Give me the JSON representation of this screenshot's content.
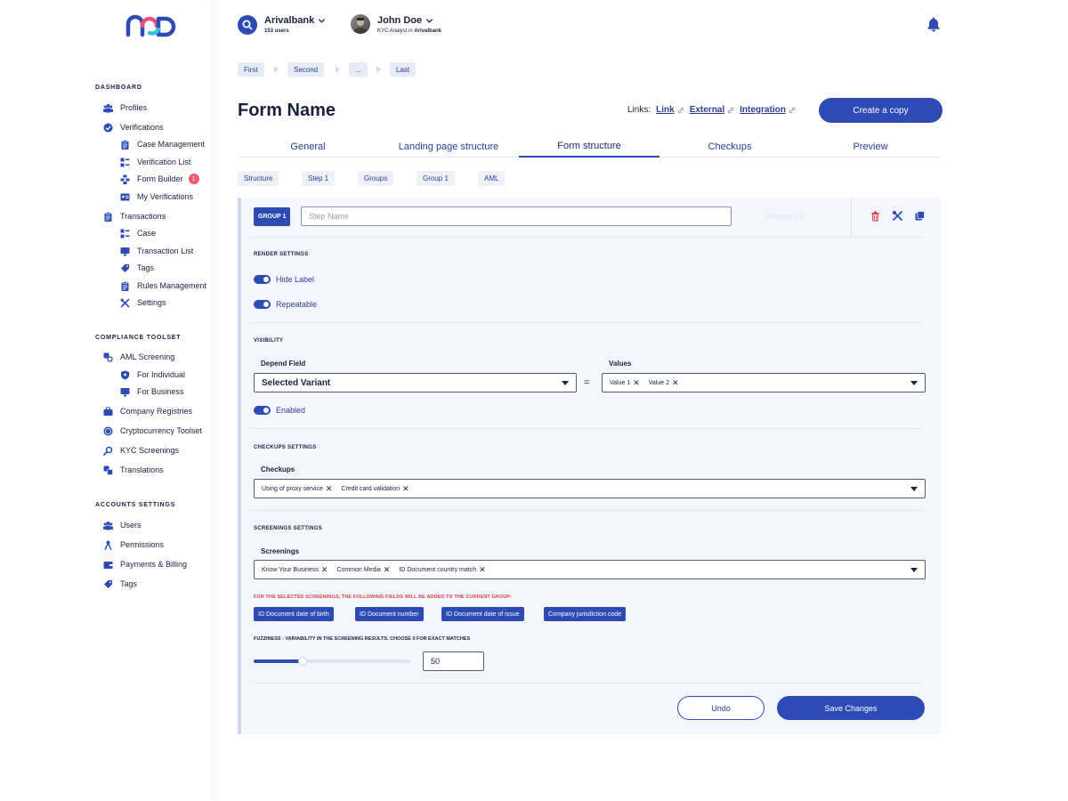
{
  "colors": {
    "primary": "#2e4bb5",
    "warning": "#d64545",
    "badge": "#f25a6a"
  },
  "sidebar": {
    "sections": [
      {
        "title": "DASHBOARD",
        "items": [
          {
            "label": "Profiles",
            "icon": "users-icon"
          },
          {
            "label": "Verifications",
            "icon": "check-shield-icon"
          },
          {
            "label": "Case Management",
            "icon": "clipboard-icon",
            "sub": true
          },
          {
            "label": "Verification List",
            "icon": "grid-list-icon",
            "sub": true
          },
          {
            "label": "Form Builder",
            "icon": "form-builder-icon",
            "sub": true,
            "badge": "1"
          },
          {
            "label": "My Verifications",
            "icon": "id-card-icon",
            "sub": true
          },
          {
            "label": "Transactions",
            "icon": "clipboard-icon"
          },
          {
            "label": "Case",
            "icon": "grid-list-icon",
            "sub": true
          },
          {
            "label": "Transaction List",
            "icon": "monitor-icon",
            "sub": true
          },
          {
            "label": "Tags",
            "icon": "tag-icon",
            "sub": true
          },
          {
            "label": "Rules Management",
            "icon": "clipboard-icon",
            "sub": true
          },
          {
            "label": "Settings",
            "icon": "tools-icon",
            "sub": true
          }
        ]
      },
      {
        "title": "COMPLIANCE TOOLSET",
        "items": [
          {
            "label": "AML Screening",
            "icon": "aml-icon"
          },
          {
            "label": "For Individual",
            "icon": "shield-icon",
            "sub": true
          },
          {
            "label": "For Business",
            "icon": "monitor-icon",
            "sub": true
          },
          {
            "label": "Company Registries",
            "icon": "briefcase-icon"
          },
          {
            "label": "Cryptocurrency Toolset",
            "icon": "coin-icon"
          },
          {
            "label": "KYC Screenings",
            "icon": "magnifier-icon"
          },
          {
            "label": "Translations",
            "icon": "translate-icon"
          }
        ]
      },
      {
        "title": "ACCOUNTS SETTINGS",
        "items": [
          {
            "label": "Users",
            "icon": "users-icon"
          },
          {
            "label": "Permissions",
            "icon": "person-key-icon"
          },
          {
            "label": "Payments & Billing",
            "icon": "wallet-icon"
          },
          {
            "label": "Tags",
            "icon": "tag-icon"
          }
        ]
      }
    ]
  },
  "header": {
    "org_name": "Arivalbank",
    "org_users": "153 users",
    "user_name": "John Doe",
    "user_role": "KYC Analyst in ",
    "user_org": "Arivalbank"
  },
  "breadcrumbs": [
    "First",
    "Second",
    "...",
    "Last"
  ],
  "page": {
    "title": "Form Name",
    "links_label": "Links:",
    "links": [
      "Link",
      "External",
      "Integration"
    ],
    "copy_button": "Create a copy"
  },
  "tabs": [
    {
      "label": "General",
      "active": false
    },
    {
      "label": "Landing page structure",
      "active": false
    },
    {
      "label": "Form structure",
      "active": true
    },
    {
      "label": "Checkups",
      "active": false
    },
    {
      "label": "Preview",
      "active": false
    }
  ],
  "subnav": [
    "Structure",
    "Step 1",
    "Groups",
    "Group 1",
    "AML"
  ],
  "panel": {
    "group_badge": "GROUP 1",
    "step_placeholder": "Step Name",
    "ghost_text": "Phases | D",
    "render_settings": {
      "title": "RENDER SETTINGS",
      "hide_label": "Hide Label",
      "repeatable": "Repeatable"
    },
    "visibility": {
      "title": "VISIBILITY",
      "depend_label": "Depend Field",
      "depend_value": "Selected Variant",
      "equals": "=",
      "values_label": "Values",
      "values": [
        "Value 1",
        "Value 2"
      ],
      "enabled": "Enabled"
    },
    "checkups": {
      "title": "CHECKUPS SETTINGS",
      "label": "Checkups",
      "values": [
        "Using of proxy service",
        "Credit card validation"
      ]
    },
    "screenings": {
      "title": "SCREENINGS SETTINGS",
      "label": "Screenings",
      "values": [
        "Know Your Business",
        "Common Media",
        "ID Document country match"
      ],
      "warning": "FOR THE SELECTED SCREENINGS, THE FOLLOWING FIELDS WILL BE ADDED TO THE CURRENT GROUP:",
      "fields": [
        "ID Document date of birth",
        "ID Document number",
        "ID Document date of issue",
        "Company jurisdiction code"
      ],
      "fuzziness_label": "FUZZINESS - VARIABILITY IN THE SCREENING RESULTS. CHOOSE 0 FOR EXACT MATCHES",
      "fuzziness_value": "50",
      "fuzziness_fraction": 0.31
    },
    "undo": "Undo",
    "save": "Save Changes"
  }
}
